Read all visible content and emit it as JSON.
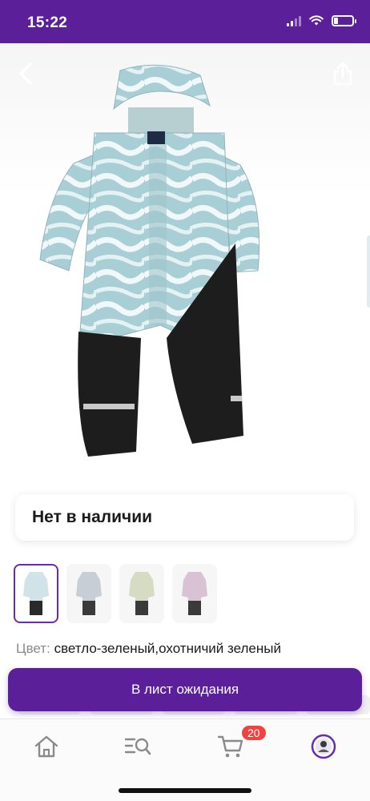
{
  "status_bar": {
    "time": "15:22"
  },
  "gallery": {
    "product_image_alt": "overall-photo"
  },
  "availability": {
    "text": "Нет в наличии"
  },
  "swatches": [
    {
      "name": "светло-зеленый",
      "top": "#cfe3e8",
      "bottom": "#2a2a2a"
    },
    {
      "name": "серый",
      "top": "#c8ced6",
      "bottom": "#3a3a3a"
    },
    {
      "name": "охотничий зеленый",
      "top": "#d6dcc2",
      "bottom": "#3a3a3a"
    },
    {
      "name": "розовый",
      "top": "#d9c2d4",
      "bottom": "#3a3a3a"
    }
  ],
  "color_info": {
    "label": "Цвет:",
    "value": "светло-зеленый,охотничий зеленый"
  },
  "wait_button": {
    "label": "В лист ожидания"
  },
  "tabbar": {
    "cart_count": "20"
  },
  "colors": {
    "brand": "#5b1f99",
    "badge": "#f24141"
  }
}
